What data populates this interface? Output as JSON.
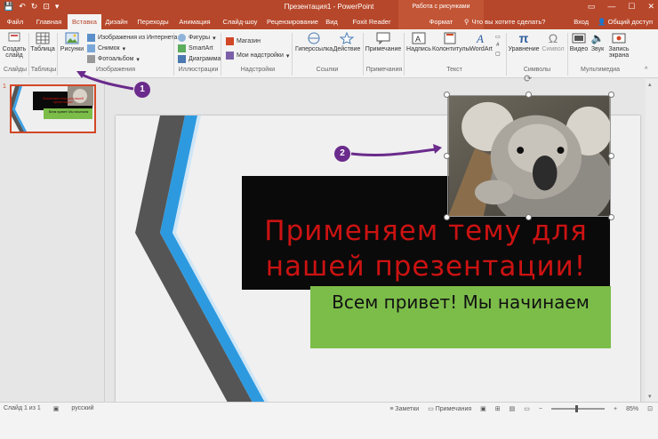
{
  "titlebar": {
    "title": "Презентация1 - PowerPoint",
    "context": "Работа с рисунками",
    "qat": [
      "💾",
      "↶",
      "↻",
      "⊡",
      "▾"
    ],
    "win": [
      "▭",
      "—",
      "☐",
      "✕"
    ]
  },
  "tabs": [
    {
      "label": "Файл"
    },
    {
      "label": "Главная"
    },
    {
      "label": "Вставка"
    },
    {
      "label": "Дизайн"
    },
    {
      "label": "Переходы"
    },
    {
      "label": "Анимация"
    },
    {
      "label": "Слайд-шоу"
    },
    {
      "label": "Рецензирование"
    },
    {
      "label": "Вид"
    },
    {
      "label": "Foxit Reader PDF"
    },
    {
      "label": "Формат"
    }
  ],
  "search": {
    "icon": "⚲",
    "placeholder": "Что вы хотите сделать?"
  },
  "tabs_right": {
    "signin": "Вход",
    "share": "Общий доступ"
  },
  "ribbon": {
    "new_slide": "Создать слайд",
    "table": "Таблица",
    "pictures": "Рисунки",
    "online_images": "Изображения из Интернета",
    "screenshot": "Снимок",
    "photo_album": "Фотоальбом",
    "shapes": "Фигуры",
    "smartart": "SmartArt",
    "chart": "Диаграмма",
    "store": "Магазин",
    "my_addins": "Мои надстройки",
    "hyperlink": "Гиперссылка",
    "action": "Действие",
    "comment": "Примечание",
    "textbox": "Надпись",
    "header_footer": "Колонтитулы",
    "wordart": "WordArt",
    "equation": "Уравнение",
    "symbol": "Символ",
    "video": "Видео",
    "audio": "Звук",
    "screen_rec": "Запись экрана",
    "groups": {
      "slides": "Слайды",
      "tables": "Таблицы",
      "images": "Изображения",
      "illustrations": "Иллюстрации",
      "addins": "Надстройки",
      "links": "Ссылки",
      "comments": "Примечания",
      "text": "Текст",
      "symbols": "Символы",
      "media": "Мультимедиа"
    }
  },
  "thumbnail": {
    "number": "1",
    "title": "Применяем тему для нашей презентации!",
    "subtitle": "Всем привет! Мы начинаем"
  },
  "slide": {
    "title": "Применяем тему для нашей презентации!",
    "subtitle": "Всем привет! Мы начинаем"
  },
  "callouts": {
    "one": "1",
    "two": "2"
  },
  "status": {
    "slide": "Слайд 1 из 1",
    "lang": "русский",
    "notes": "Заметки",
    "comments": "Примечания",
    "zoom": "85%"
  },
  "colors": {
    "accent": "#b7472a",
    "callout": "#6a2b8c",
    "title_red": "#cc1212",
    "green": "#7cbd4a"
  }
}
